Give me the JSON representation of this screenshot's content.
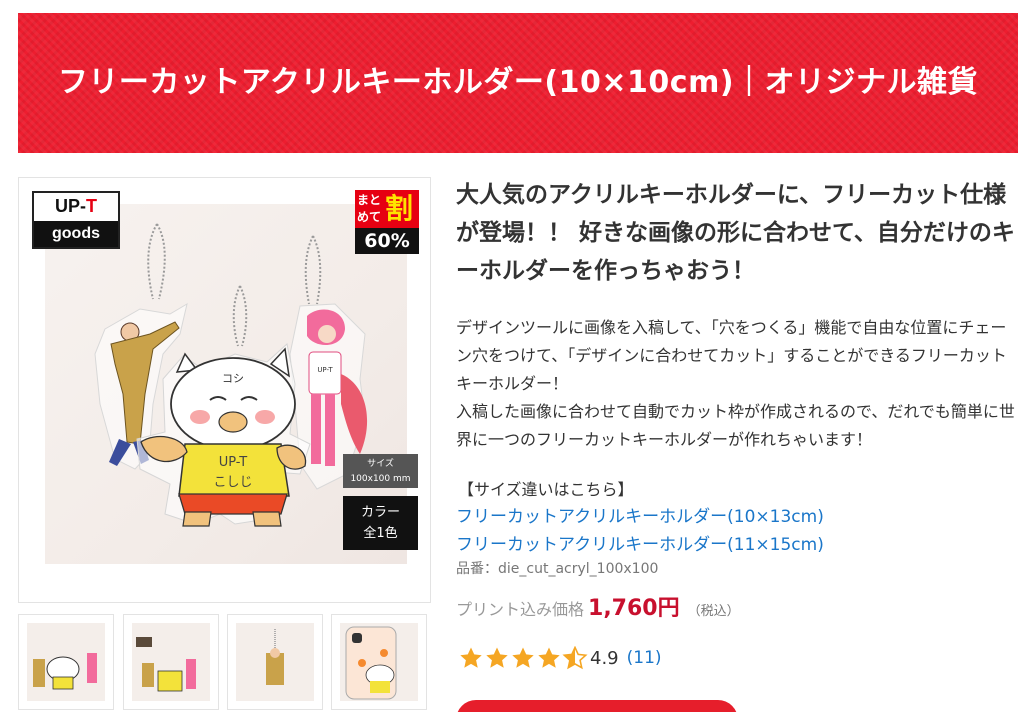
{
  "title": "フリーカットアクリルキーホルダー(10×10cm)｜オリジナル雑貨",
  "badges": {
    "brand_top_main": "UP-",
    "brand_top_accent": "T",
    "brand_bottom": "goods",
    "discount_line1": "まと",
    "discount_line2": "めて",
    "discount_kanji": "割",
    "discount_percent": "60%",
    "size_label": "サイズ",
    "size_value": "100x100 mm",
    "color_label": "カラー",
    "color_value": "全1色"
  },
  "artwork": {
    "cat_text_line1": "UP-T",
    "cat_text_line2": "こしじ",
    "cat_head_text": "コシ",
    "girl_shirt_text": "UP-T"
  },
  "headline": "大人気のアクリルキーホルダーに、フリーカット仕様が登場！！ 好きな画像の形に合わせて、自分だけのキーホルダーを作っちゃおう！",
  "description": [
    "デザインツールに画像を入稿して、「穴をつくる」機能で自由な位置にチェーン穴をつけて、「デザインに合わせてカット」することができるフリーカットキーホルダー！",
    "入稿した画像に合わせて自動でカット枠が作成されるので、だれでも簡単に世界に一つのフリーカットキーホルダーが作れちゃいます！"
  ],
  "size_heading": "【サイズ違いはこちら】",
  "size_links": [
    "フリーカットアクリルキーホルダー(10×13cm)",
    "フリーカットアクリルキーホルダー(11×15cm)"
  ],
  "product_code": "品番：die_cut_acryl_100x100",
  "price": {
    "label": "プリント込み価格",
    "value": "1,760円",
    "tax_note": "（税込）"
  },
  "rating": {
    "value": "4.9",
    "count": "(11)",
    "stars": 4.5,
    "star_color": "#f5a623"
  },
  "colors": {
    "brand_red": "#ee1d2f",
    "link_blue": "#1a76c9",
    "price_red": "#c8102e"
  },
  "icons": [
    "star-icon",
    "half-star-icon"
  ]
}
